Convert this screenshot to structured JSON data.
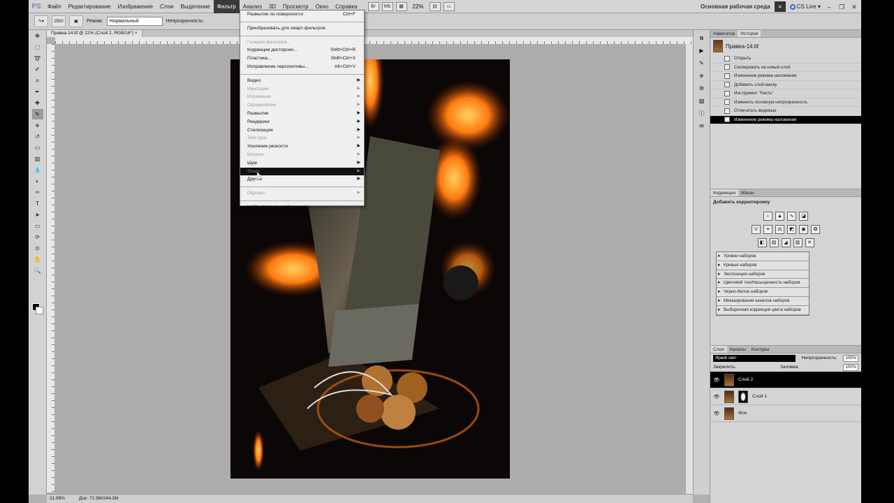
{
  "menubar": {
    "logo": "PS",
    "items": [
      "Файл",
      "Редактирование",
      "Изображение",
      "Слои",
      "Выделение",
      "Фильтр",
      "Анализ",
      "3D",
      "Просмотр",
      "Окно",
      "Справка"
    ],
    "active_index": 5,
    "zoom": "22%",
    "workspace": "Основная рабочая среда",
    "cslive": "CS Live"
  },
  "options": {
    "brush_size": "2500",
    "mode_label": "Режим:",
    "mode_value": "Нормальный",
    "opacity_label": "Непрозрачность:"
  },
  "document": {
    "tab": "Правка-14.tif @ 22% (Слой 2, RGB/16*)"
  },
  "status": {
    "zoom": "21.99%",
    "doc": "Док: 73.3M/244.2M"
  },
  "filter_menu": {
    "items": [
      {
        "label": "Размытие по поверхности",
        "shortcut": "Ctrl+F",
        "state": "normal"
      },
      {
        "sep": true
      },
      {
        "label": "Преобразовать для смарт-фильтров",
        "state": "normal"
      },
      {
        "sep": true
      },
      {
        "label": "Галерея фильтров...",
        "state": "disabled"
      },
      {
        "label": "Коррекция дисторсии...",
        "shortcut": "Shift+Ctrl+R",
        "state": "normal"
      },
      {
        "label": "Пластика...",
        "shortcut": "Shift+Ctrl+X",
        "state": "normal"
      },
      {
        "label": "Исправление перспективы...",
        "shortcut": "Alt+Ctrl+V",
        "state": "normal"
      },
      {
        "sep": true
      },
      {
        "label": "Видео",
        "submenu": true,
        "state": "normal"
      },
      {
        "label": "Имитация",
        "submenu": true,
        "state": "disabled"
      },
      {
        "label": "Искажение",
        "submenu": true,
        "state": "disabled"
      },
      {
        "label": "Оформление",
        "submenu": true,
        "state": "disabled"
      },
      {
        "label": "Размытие",
        "submenu": true,
        "state": "normal"
      },
      {
        "label": "Рендеринг",
        "submenu": true,
        "state": "normal"
      },
      {
        "label": "Стилизация",
        "submenu": true,
        "state": "normal"
      },
      {
        "label": "Текстура",
        "submenu": true,
        "state": "disabled"
      },
      {
        "label": "Усиление резкости",
        "submenu": true,
        "state": "normal"
      },
      {
        "label": "Штрихи",
        "submenu": true,
        "state": "disabled"
      },
      {
        "label": "Шум",
        "submenu": true,
        "state": "normal"
      },
      {
        "label": "Эскиз",
        "submenu": true,
        "state": "highlighted"
      },
      {
        "label": "Другие",
        "submenu": true,
        "state": "normal"
      },
      {
        "sep": true
      },
      {
        "label": "Digimarc",
        "submenu": true,
        "state": "disabled"
      },
      {
        "sep": true
      },
      {
        "label": "Найти фильтры в Интернете...",
        "state": "normal"
      }
    ]
  },
  "history_panel": {
    "tabs": [
      "Навигатор",
      "История"
    ],
    "snapshot": "Правка-14.tif",
    "items": [
      "Открыть",
      "Скопировать на новый слой",
      "Изменение режима наложения",
      "Добавить слой-маску",
      "Инструмент \"Кисть\"",
      "Изменить основную непрозрачность",
      "Отпечатать видимые",
      "Изменение режима наложения"
    ],
    "selected_index": 7
  },
  "adjust_panel": {
    "tabs": [
      "Коррекция",
      "Маски"
    ],
    "title": "Добавить корректировку",
    "presets": [
      "Уровни наборов",
      "Кривые наборов",
      "Экспозиция наборов",
      "Цветовой тон/Насыщенность наборов",
      "Черно-белое наборов",
      "Микширование каналов наборов",
      "Выборочная коррекция цвета наборов"
    ]
  },
  "layers_panel": {
    "tabs": [
      "Слои",
      "Каналы",
      "Контуры"
    ],
    "blend_mode": "Яркий свет",
    "opacity_label": "Непрозрачность:",
    "opacity_value": "100%",
    "lock_label": "Закрепить:",
    "fill_label": "Заливка:",
    "fill_value": "100%",
    "layers": [
      "Слой 2",
      "Слой 1",
      "Фон"
    ],
    "selected_index": 0
  },
  "colors": {
    "menu_active": "#3a3a3a",
    "history_selected": "#000000",
    "flame": "#ff7a10"
  }
}
